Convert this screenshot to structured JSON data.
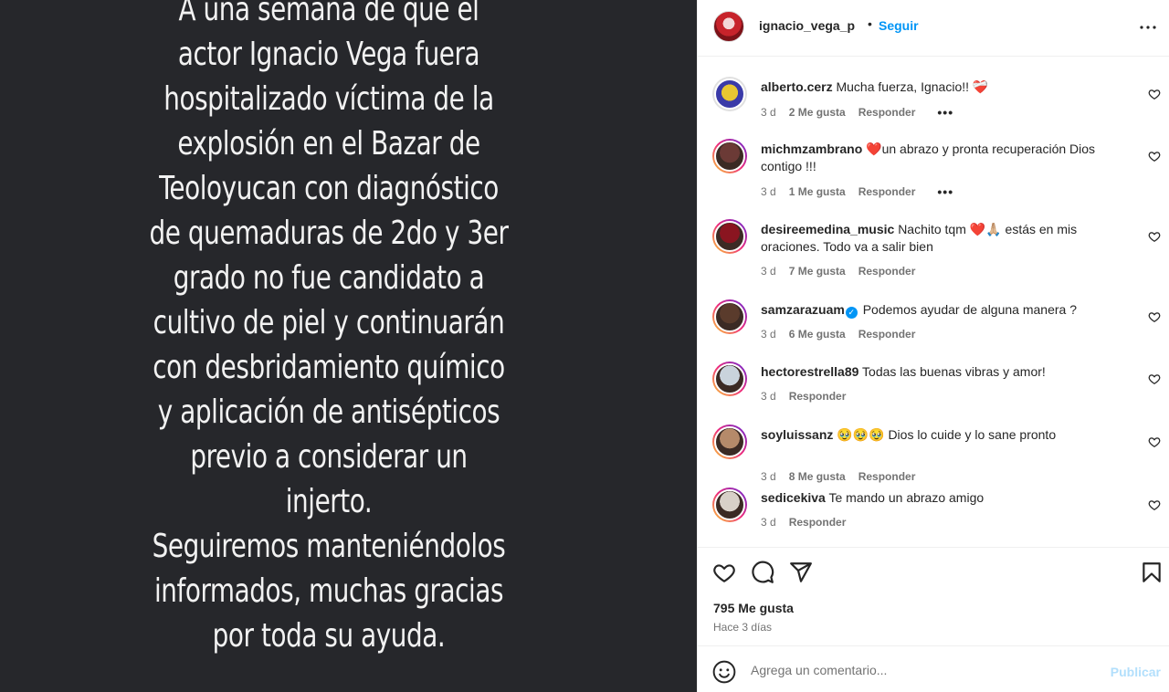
{
  "post": {
    "lines": [
      "A una semana de que el",
      "actor Ignacio Vega fuera",
      "hospitalizado víctima de la",
      "explosión en el Bazar de",
      "Teoloyucan con diagnóstico",
      "de quemaduras de 2do y 3er",
      "grado no fue candidato a",
      "cultivo de piel y continuarán",
      "con desbridamiento químico",
      "y aplicación de antisépticos",
      "previo a considerar un",
      "injerto.",
      "Seguiremos manteniéndolos",
      "informados, muchas gracias",
      "por toda su ayuda."
    ]
  },
  "header": {
    "username": "ignacio_vega_p",
    "separator": "•",
    "follow_label": "Seguir",
    "more_icon": "more-horizontal-icon"
  },
  "comments": [
    {
      "user": "alberto.cerz",
      "text": "Mucha fuerza, Ignacio!! ❤️‍🩹",
      "time": "3 d",
      "likes": "2 Me gusta",
      "reply": "Responder",
      "more": "•••",
      "avatar_color": "#e8c632",
      "ring": false
    },
    {
      "user": "michmzambrano",
      "text": "❤️un abrazo y pronta recuperación Dios contigo !!!",
      "time": "3 d",
      "likes": "1 Me gusta",
      "reply": "Responder",
      "more": "•••",
      "avatar_color": "#6b3a36",
      "ring": true
    },
    {
      "user": "desireemedina_music",
      "text": "Nachito tqm ❤️🙏🏼 estás en mis oraciones. Todo va a salir bien",
      "time": "3 d",
      "likes": "7 Me gusta",
      "reply": "Responder",
      "avatar_color": "#8a1520",
      "ring": true
    },
    {
      "user": "samzarazuam",
      "verified": true,
      "text": "Podemos ayudar de alguna manera ?",
      "time": "3 d",
      "likes": "6 Me gusta",
      "reply": "Responder",
      "avatar_color": "#5a3b2c",
      "ring": true
    },
    {
      "user": "hectorestrella89",
      "text": "Todas las buenas vibras y amor!",
      "time": "3 d",
      "likes": "",
      "reply": "Responder",
      "avatar_color": "#c9d3dc",
      "ring": true
    },
    {
      "user": "soyluissanz",
      "text": "🥹🥹🥹 Dios lo cuide y lo sane pronto",
      "time": "3 d",
      "likes": "8 Me gusta",
      "reply": "Responder",
      "avatar_color": "#b58a6a",
      "ring": true
    },
    {
      "user": "sedicekiva",
      "text": "Te mando un abrazo amigo",
      "time": "3 d",
      "likes": "",
      "reply": "Responder",
      "avatar_color": "#d8d0c8",
      "ring": true
    }
  ],
  "actions": {
    "like_icon": "heart-icon",
    "comment_icon": "comment-icon",
    "share_icon": "share-icon",
    "save_icon": "bookmark-icon",
    "likes_count": "795 Me gusta",
    "posted": "Hace 3 días"
  },
  "composer": {
    "placeholder": "Agrega un comentario...",
    "publish_label": "Publicar",
    "emoji_icon": "smile-icon"
  }
}
